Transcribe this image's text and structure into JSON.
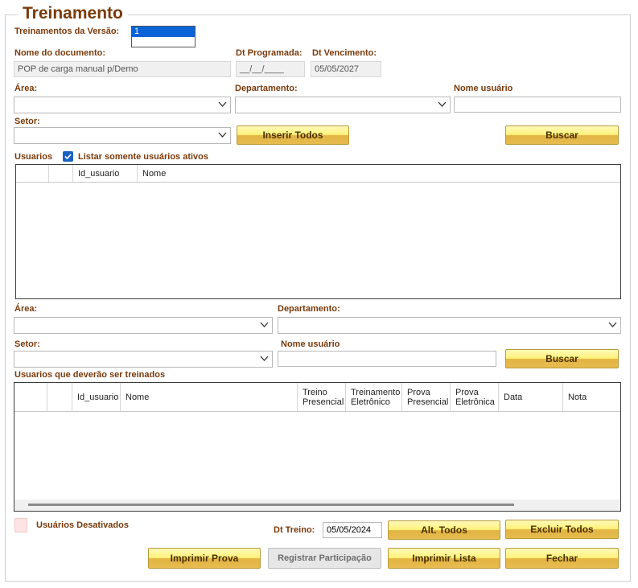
{
  "form": {
    "title": "Treinamento"
  },
  "version": {
    "label": "Treinamentos da Versão:",
    "items": [
      "1"
    ]
  },
  "document": {
    "name_label": "Nome do documento:",
    "name_value": "POP de carga manual p/Demo",
    "dt_prog_label": "Dt Programada:",
    "dt_prog_value": "__/__/____",
    "dt_venc_label": "Dt Vencimento:",
    "dt_venc_value": "05/05/2027"
  },
  "filters_top": {
    "area_label": "Área:",
    "depto_label": "Departamento:",
    "nome_label": "Nome usuário",
    "setor_label": "Setor:",
    "inserir_todos": "Inserir Todos",
    "buscar": "Buscar"
  },
  "usuarios": {
    "label": "Usuarios",
    "ativos_label": "Listar somente usuários ativos",
    "columns": [
      "Id_usuario",
      "Nome"
    ]
  },
  "filters_bottom": {
    "area_label": "Área:",
    "depto_label": "Departamento:",
    "setor_label": "Setor:",
    "nome_label": "Nome usuário",
    "buscar": "Buscar"
  },
  "treinar": {
    "label": "Usuarios que deverão ser treinados",
    "columns": {
      "id": "Id_usuario",
      "nome": "Nome",
      "treino_l1": "Treino",
      "treino_l2": "Presencial",
      "treel_l1": "Treinamento",
      "treel_l2": "Eletrônico",
      "provap_l1": "Prova",
      "provap_l2": "Presencial",
      "provae_l1": "Prova",
      "provae_l2": "Eletrônica",
      "data": "Data",
      "nota": "Nota"
    }
  },
  "footer": {
    "desativados_label": "Usuários Desativados",
    "dt_treino_label": "Dt Treino:",
    "dt_treino_value": "05/05/2024",
    "alt_todos": "Alt. Todos",
    "excluir_todos": "Excluir Todos",
    "imprimir_prova": "Imprimir Prova",
    "registrar": "Registrar Participação",
    "imprimir_lista": "Imprimir Lista",
    "fechar": "Fechar"
  },
  "colors": {
    "label": "#7a3a0a",
    "button_top": "#fff27a",
    "button_bottom": "#e2b443",
    "checkbox": "#1a62c2",
    "desativados_swatch": "#fde3e3"
  }
}
